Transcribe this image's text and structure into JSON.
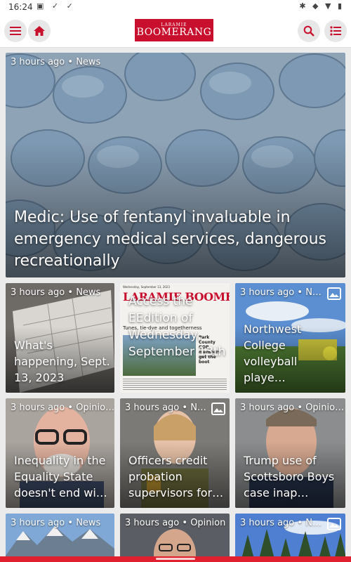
{
  "status": {
    "time": "16:24"
  },
  "header": {
    "logo_small": "LARAMIE",
    "logo_big": "BOOMERANG"
  },
  "hero": {
    "meta": "3 hours ago • News",
    "headline": "Medic: Use of fentanyl invaluable in emergency medical services, dangerous recreationally"
  },
  "cards": [
    {
      "meta": "3 hours ago • News",
      "headline": "What's happening, Sept. 13, 2023"
    },
    {
      "meta": "",
      "headline": "Access the EEdition of Wednesday, September 13th"
    },
    {
      "meta": "3 hours ago • N…",
      "headline": "Northwest College volleyball playe…"
    },
    {
      "meta": "3 hours ago • Opinio…",
      "headline": "Inequality in the Equality State doesn't end wi…"
    },
    {
      "meta": "3 hours ago • N…",
      "headline": "Officers credit probation supervisors for…"
    },
    {
      "meta": "3 hours ago • Opinio…",
      "headline": "Trump use of Scottsboro Boys case inap…"
    },
    {
      "meta": "3 hours ago • News",
      "headline": ""
    },
    {
      "meta": "3 hours ago • Opinion",
      "headline": ""
    },
    {
      "meta": "3 hours ago • N…",
      "headline": ""
    }
  ],
  "newspaper": {
    "masthead": "LARAMIE BOOMERANG",
    "dateline": "Wednesday, September 13, 2023",
    "teaser": "Tunes, tie-dye and togetherness",
    "side_story": "Park County GOP members get the boot"
  },
  "colors": {
    "brand": "#c8102e",
    "nav": "#e0202e"
  }
}
